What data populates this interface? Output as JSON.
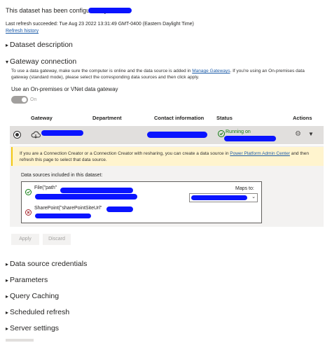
{
  "header": {
    "configured_text": "This dataset has been configured by",
    "last_refresh_text": "Last refresh succeeded: Tue Aug 23 2022 13:31:49 GMT-0400 (Eastern Daylight Time)",
    "refresh_history_link": "Refresh history"
  },
  "sections": {
    "dataset_description": "Dataset description",
    "gateway_connection": "Gateway connection",
    "data_source_credentials": "Data source credentials",
    "parameters": "Parameters",
    "query_caching": "Query Caching",
    "scheduled_refresh": "Scheduled refresh",
    "server_settings": "Server settings"
  },
  "gateway": {
    "description_part1": "To use a data gateway, make sure the computer is online and the data source is added in",
    "manage_gateways_link": "Manage Gateways",
    "description_part2": ". If you're using an On-premises data gateway (standard mode), please select the corresponding data sources and then click apply.",
    "use_label": "Use an On-premises or VNet data gateway",
    "toggle_state": "On",
    "columns": [
      "Gateway",
      "Department",
      "Contact information",
      "Status",
      "Actions"
    ],
    "status_text": "Running on",
    "warning_part1": "If you are a Connection Creator or a Connection Creator with resharing, you can create a data source in",
    "power_platform_link": "Power Platform Admin Center",
    "warning_part2": "and then refresh this page to select that data source.",
    "ds_included_label": "Data sources included in this dataset:",
    "ds_items": [
      "File(\"path\"",
      "SharePoint(\"sharePointSiteUrl\""
    ],
    "maps_to_label": "Maps to:",
    "apply_label": "Apply",
    "discard_label": "Discard"
  },
  "colors": {
    "redaction": "#0a14ff",
    "link": "#1b5ba8",
    "success": "#107c10",
    "error": "#a4262c",
    "warning_bg": "#fff4ce"
  }
}
